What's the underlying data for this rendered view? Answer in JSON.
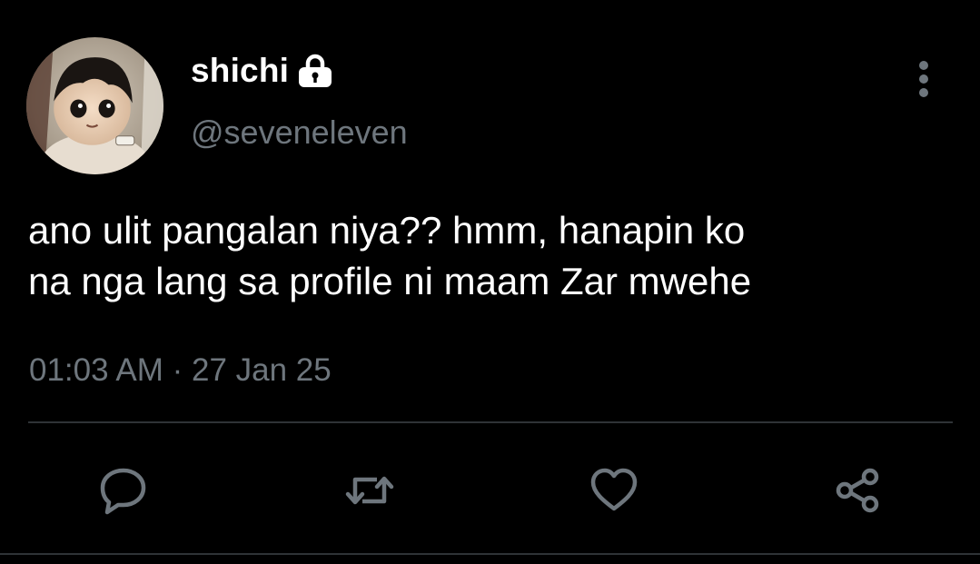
{
  "author": {
    "display_name": "shichi",
    "handle": "@seveneleven",
    "protected_icon": "lock-icon",
    "avatar": "profile-photo"
  },
  "tweet": {
    "text_lines": [
      "ano ulit pangalan niya?? hmm, hanapin ko",
      "na nga lang sa profile ni maam Zar mwehe"
    ],
    "timestamp": "01:03 AM · 27 Jan 25"
  },
  "actions": {
    "more": "more-vertical-icon",
    "reply": "reply-icon",
    "retweet": "retweet-icon",
    "like": "heart-icon",
    "share": "share-icon"
  },
  "colors": {
    "background": "#000000",
    "primary_text": "#ffffff",
    "secondary_text": "#6e767d",
    "divider": "#2f3336",
    "icon": "#6e767d"
  }
}
